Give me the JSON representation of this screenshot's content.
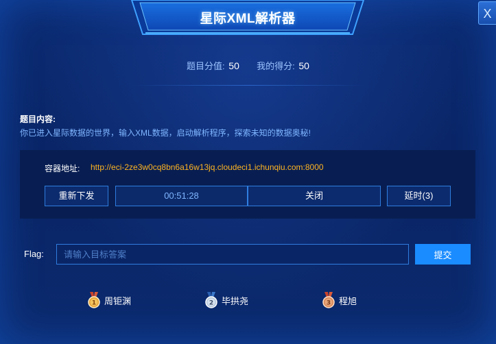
{
  "window": {
    "title": "星际XML解析器",
    "close_label": "X"
  },
  "scores": {
    "question_score_label": "题目分值:",
    "question_score_value": "50",
    "my_score_label": "我的得分:",
    "my_score_value": "50"
  },
  "description": {
    "label": "题目内容:",
    "text": "你已进入星际数据的世界，输入XML数据，启动解析程序，探索未知的数据奥秘!"
  },
  "container": {
    "address_label": "容器地址:",
    "address_url": "http://eci-2ze3w0cq8bn6a16w13jq.cloudeci1.ichunqiu.com:8000",
    "resend_label": "重新下发",
    "timer": "00:51:28",
    "close_label": "关闭",
    "extend_label": "延时(3)"
  },
  "flag": {
    "label": "Flag:",
    "placeholder": "请输入目标答案",
    "value": "",
    "submit_label": "提交"
  },
  "ranking": [
    {
      "rank": "1",
      "name": "周钜渊",
      "medal_color": "#e8a23a"
    },
    {
      "rank": "2",
      "name": "毕拱尧",
      "medal_color": "#b9c9dd"
    },
    {
      "rank": "3",
      "name": "程旭",
      "medal_color": "#d9895a"
    }
  ],
  "colors": {
    "background": "#0a2a6e",
    "accent": "#1a8cff",
    "link": "#ffb422",
    "muted_text": "#7fb6ff"
  }
}
